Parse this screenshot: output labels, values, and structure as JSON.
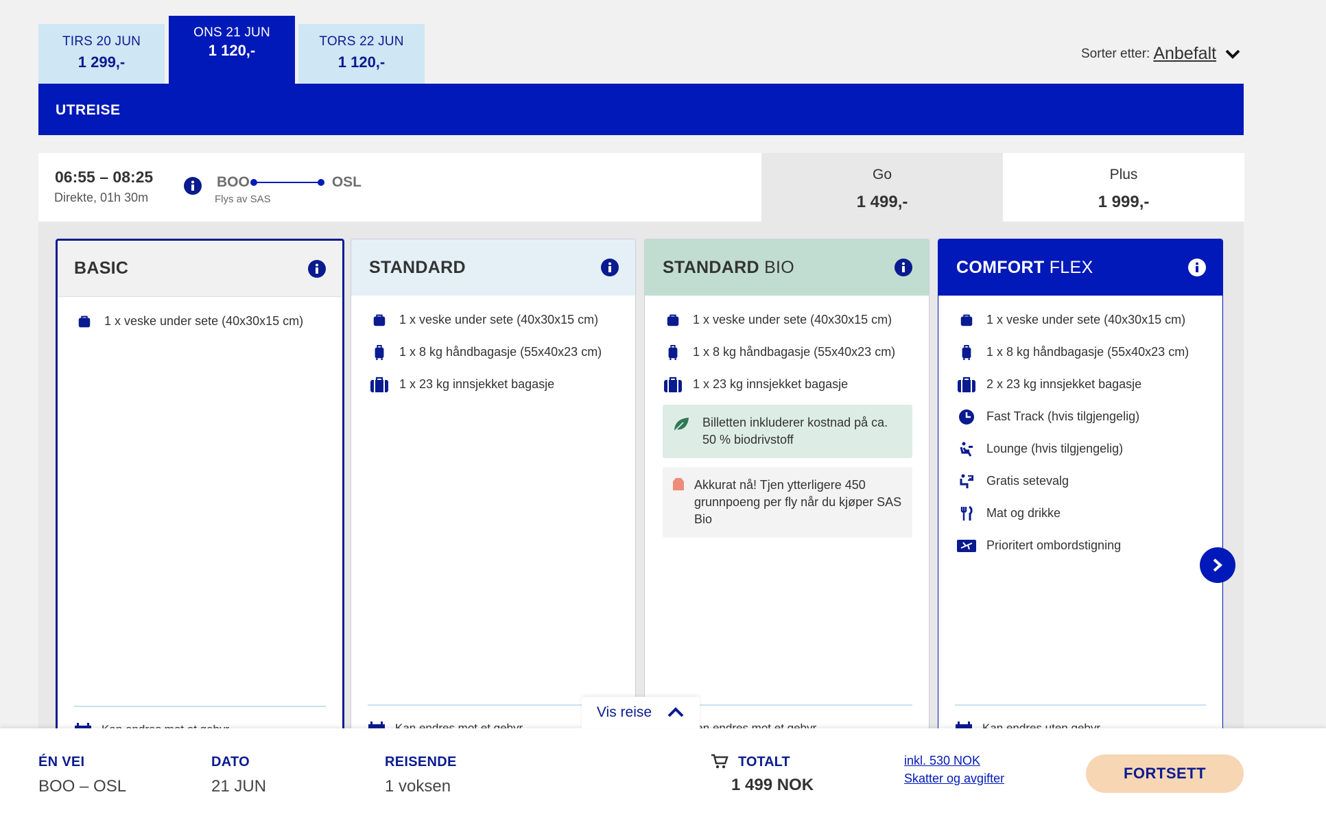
{
  "date_tabs": [
    {
      "day": "TIRS 20 JUN",
      "price": "1 299,-"
    },
    {
      "day": "ONS 21 JUN",
      "price": "1 120,-"
    },
    {
      "day": "TORS 22 JUN",
      "price": "1 120,-"
    }
  ],
  "sort": {
    "label": "Sorter etter:",
    "value": "Anbefalt"
  },
  "direction_label": "UTREISE",
  "flight": {
    "times": "06:55 – 08:25",
    "duration": "Direkte, 01h 30m",
    "from": "BOO",
    "to": "OSL",
    "operated_by": "Flys av SAS"
  },
  "price_options": [
    {
      "label": "Go",
      "price": "1 499,-"
    },
    {
      "label": "Plus",
      "price": "1 999,-"
    }
  ],
  "fares": [
    {
      "name_bold": "BASIC",
      "name_thin": "",
      "features": [
        "1 x veske under sete (40x30x15 cm)"
      ],
      "footer": "Kan endres mot et gebyr"
    },
    {
      "name_bold": "STANDARD",
      "name_thin": "",
      "features": [
        "1 x veske under sete (40x30x15 cm)",
        "1 x 8 kg håndbagasje (55x40x23 cm)",
        "1 x 23 kg innsjekket bagasje"
      ],
      "footer": "Kan endres mot et gebyr"
    },
    {
      "name_bold": "STANDARD",
      "name_thin": " BIO",
      "features": [
        "1 x veske under sete (40x30x15 cm)",
        "1 x 8 kg håndbagasje (55x40x23 cm)",
        "1 x 23 kg innsjekket bagasje"
      ],
      "note_green": "Billetten inkluderer kostnad på ca. 50 % biodrivstoff",
      "note_grey": "Akkurat nå! Tjen ytterligere 450 grunnpoeng per fly når du kjøper SAS Bio",
      "footer": "Kan endres mot et gebyr"
    },
    {
      "name_bold": "COMFORT",
      "name_thin": " FLEX",
      "features": [
        "1 x veske under sete (40x30x15 cm)",
        "1 x 8 kg håndbagasje (55x40x23 cm)",
        "2 x 23 kg innsjekket bagasje",
        "Fast Track (hvis tilgjengelig)",
        "Lounge (hvis tilgjengelig)",
        "Gratis setevalg",
        "Mat og drikke",
        "Prioritert ombordstigning"
      ],
      "footer": "Kan endres uten gebyr"
    }
  ],
  "vis_reise": "Vis reise",
  "summary": {
    "trip_type_label": "ÉN VEI",
    "trip_type_value": "BOO – OSL",
    "date_label": "DATO",
    "date_value": "21 JUN",
    "travellers_label": "REISENDE",
    "travellers_value": "1 voksen",
    "total_label": "TOTALT",
    "total_value": "1 499 NOK",
    "taxes_line1": "inkl. 530 NOK",
    "taxes_line2": "Skatter og avgifter",
    "continue_label": "FORTSETT"
  },
  "colors": {
    "primary": "#0019b8",
    "bio": "#c1ddd1",
    "standard": "#e4f0f6",
    "cta": "#f7d6b4"
  }
}
